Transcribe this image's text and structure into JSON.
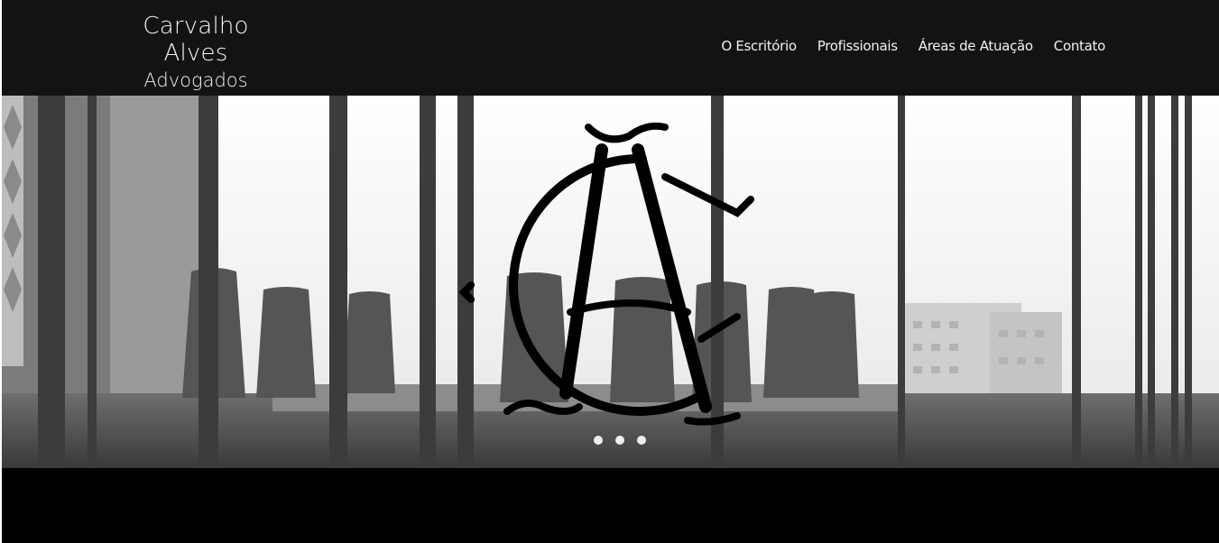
{
  "header": {
    "logo": {
      "line1": "Carvalho Alves",
      "line2": "Advogados"
    },
    "nav": [
      {
        "label": "O Escritório"
      },
      {
        "label": "Profissionais"
      },
      {
        "label": "Áreas de Atuação"
      },
      {
        "label": "Contato"
      }
    ]
  },
  "hero": {
    "photo": "black-and-white meeting room with chairs and glass walls",
    "emblem": "CA monogram",
    "slides_total": 3,
    "active_slide": 1
  },
  "colors": {
    "header_bg": "#131313",
    "header_text": "#f2f2f2",
    "footer_bg": "#000000",
    "emblem": "#000000"
  }
}
